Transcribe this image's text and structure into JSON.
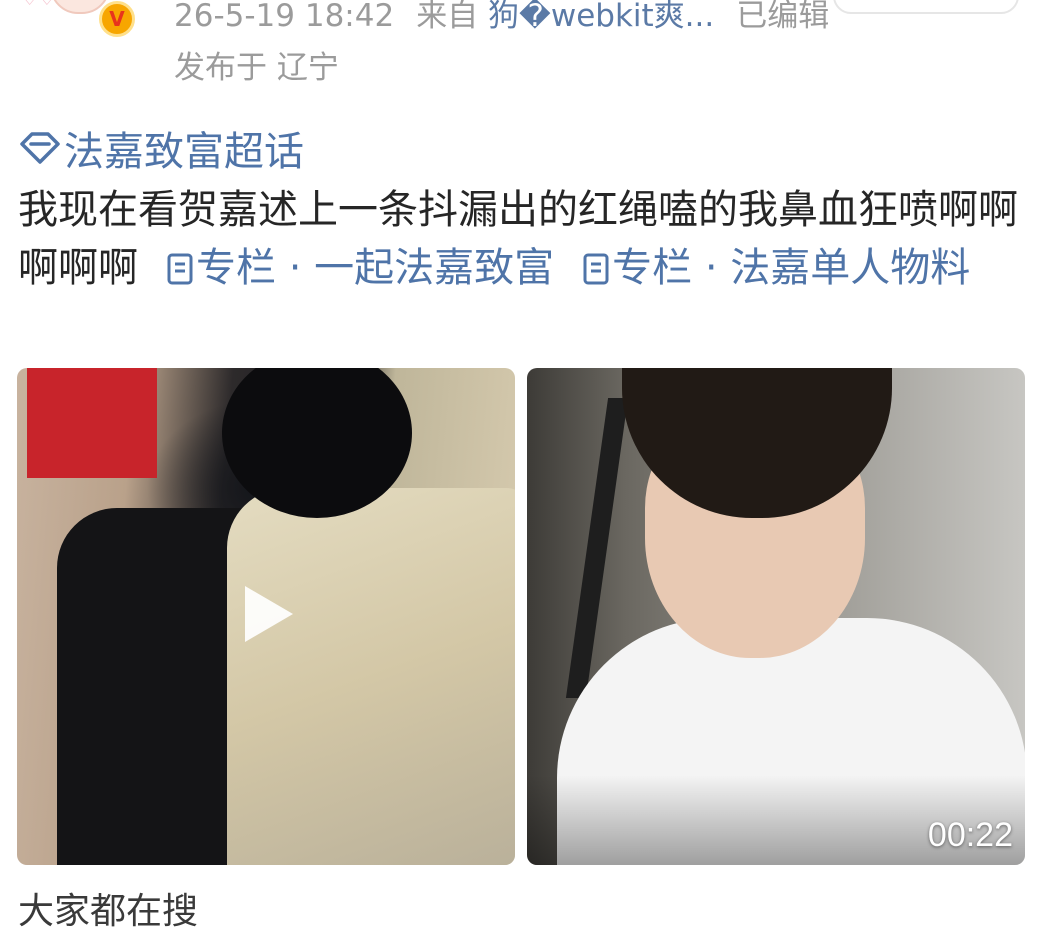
{
  "header": {
    "timestamp": "26-5-19 18:42",
    "from_label": "来自",
    "source": "狗�webkit爽...",
    "edited": "已编辑",
    "location": "发布于 辽宁",
    "follow_label": ""
  },
  "post": {
    "topic": "法嘉致富超话",
    "text": "我现在看贺嘉述上一条抖漏出的红绳嗑的我鼻血狂喷啊啊啊啊啊",
    "column_link_1": "专栏 · 一起法嘉致富",
    "column_link_2": "专栏 · 法嘉单人物料"
  },
  "media": [
    {
      "kind": "video",
      "play_icon": "play-icon"
    },
    {
      "kind": "video",
      "duration": "00:22"
    }
  ],
  "next_section": "大家都在搜",
  "colors": {
    "link": "#4f74a8",
    "meta": "#9b9b9b",
    "badge": "#f7a600"
  }
}
